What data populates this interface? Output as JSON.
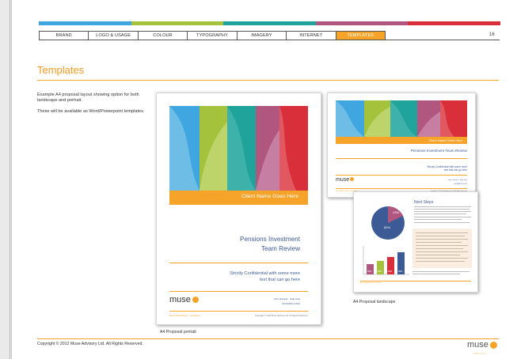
{
  "colors": {
    "accent": "#f6a329",
    "navy": "#3c5b96",
    "stripes": [
      "#3fa6df",
      "#a5c23c",
      "#20a39b",
      "#b1577f",
      "#d92f3a"
    ]
  },
  "nav": {
    "tabs": [
      "BRAND",
      "LOGO & USAGE",
      "COLOUR",
      "TYPOGRAPHY",
      "IMAGERY",
      "INTERNET",
      "TEMPLATES"
    ],
    "active": "TEMPLATES",
    "page_number": "16"
  },
  "page": {
    "title": "Templates",
    "body1": "Example A4 proposal layout showing option for both landscape and portrait.",
    "body2": "These will be available as Word/Powerpoint templates."
  },
  "portrait": {
    "client": "Client Name Goes Here",
    "title_line1": "Pensions Investment",
    "title_line2": "Team Review",
    "sub_line1": "Strictly Confidential with some more",
    "sub_line2": "text that can go here",
    "logo": "muse",
    "authors": "John Sample · Sally Doe",
    "date": "30 MARCH 2012",
    "footer_left": "Muse Independently · consultancy",
    "footer_right": "Copyright © 2012 Muse Advisory Ltd. All Rights Reserved.",
    "caption": "A4 Proposal portrait"
  },
  "landscape": {
    "client": "Client Name Goes Here",
    "title": "Pensions Investment Team Review",
    "sub_line1": "Strictly Confidential with some more",
    "sub_line2": "text that can go here",
    "logo": "muse",
    "authors": "John Sample · Sally Doe",
    "date": "30 MARCH 2012",
    "footer_left": "Muse Independently · consultancy",
    "footer_right": "Copyright © 2012 Muse Advisory Ltd. All Rights Reserved."
  },
  "next_steps": {
    "title": "Next Steps",
    "pie_labels": [
      "23%",
      "82%"
    ],
    "bar_labels": [
      "80%",
      "85%",
      "90%",
      "95%"
    ],
    "footer": "Muse Independently · consultancy",
    "caption": "A4 Proposal landscape"
  },
  "footer": {
    "copyright": "Copyright © 2012 Muse Advisory Ltd. All Rights Reserved.",
    "logo": "muse",
    "logo_tagline": "advisory"
  }
}
